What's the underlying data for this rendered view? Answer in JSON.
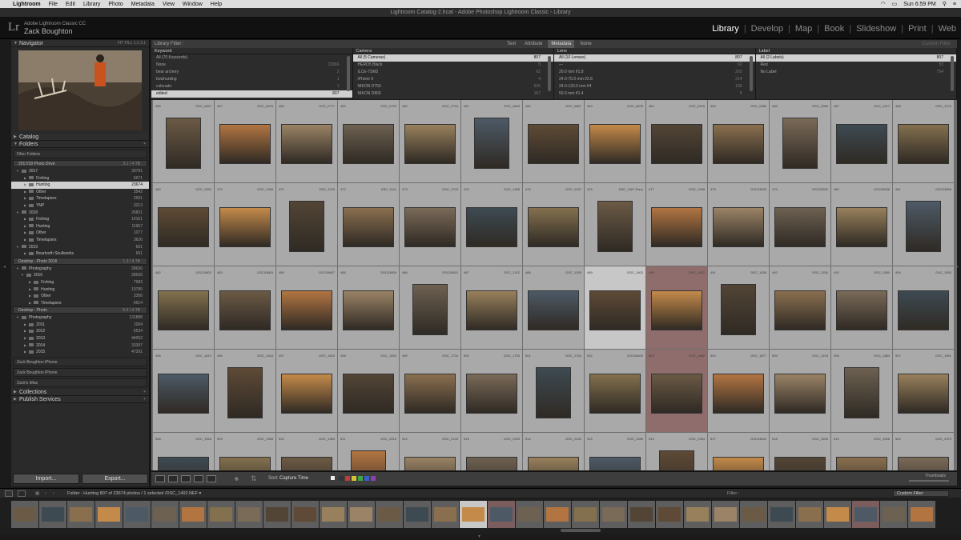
{
  "menubar": {
    "app": "Lightroom",
    "menus": [
      "File",
      "Edit",
      "Library",
      "Photo",
      "Metadata",
      "View",
      "Window",
      "Help"
    ],
    "clock": "Sun 6:59 PM"
  },
  "window_title": "Lightroom Catalog-2.lrcat - Adobe Photoshop Lightroom Classic - Library",
  "identity": {
    "logo": "Lr",
    "line1": "Adobe Lightroom Classic CC",
    "line2": "Zack Boughton"
  },
  "modules": {
    "library": "Library",
    "develop": "Develop",
    "map": "Map",
    "book": "Book",
    "slideshow": "Slideshow",
    "print": "Print",
    "web": "Web",
    "sep": "|"
  },
  "left": {
    "navigator": "Navigator",
    "nav_zoom": "FIT  FILL  1:1  3:1",
    "catalog": "Catalog",
    "folders": "Folders",
    "filter_placeholder": "Filter Folders",
    "vol1": {
      "name": "2017/18 Photo Drive",
      "n": "3.1 / 4 TB"
    },
    "f2017": {
      "name": "2017",
      "n": "39791"
    },
    "f_fishing": {
      "name": "Fishing",
      "n": "6671"
    },
    "f_hunting": {
      "name": "Hunting",
      "n": "23674"
    },
    "f_other": {
      "name": "Other",
      "n": "3542"
    },
    "f_timelapses": {
      "name": "Timelapses",
      "n": "2691"
    },
    "f_ynp": {
      "name": "YNP",
      "n": "3213"
    },
    "f2018": {
      "name": "2018",
      "n": "26831"
    },
    "f18_fishing": {
      "name": "Fishing",
      "n": "10161"
    },
    "f18_hunting": {
      "name": "Hunting",
      "n": "11967"
    },
    "f18_other": {
      "name": "Other",
      "n": "1077"
    },
    "f18_time": {
      "name": "Timelapses",
      "n": "3626"
    },
    "f2019": {
      "name": "2019",
      "n": "691"
    },
    "f19_bs": {
      "name": "Beartooth Skullworks",
      "n": "691"
    },
    "vol2": {
      "name": "Desktop - Photo 2016",
      "n": "1.3 / 4 TB"
    },
    "d_photo": {
      "name": "Photography",
      "n": "28636"
    },
    "d2016": {
      "name": "2016",
      "n": "28636"
    },
    "d16_fish": {
      "name": "Fishing",
      "n": "7983"
    },
    "d16_hunt": {
      "name": "Hunting",
      "n": "10785"
    },
    "d16_other": {
      "name": "Other",
      "n": "3356"
    },
    "d16_time": {
      "name": "Timelapses",
      "n": "6514"
    },
    "vol3": {
      "name": "Desktop - Photo",
      "n": "0.6 / 4 TB"
    },
    "e_photo": {
      "name": "Photography",
      "n": "131888"
    },
    "e2011": {
      "name": "2011",
      "n": "1004"
    },
    "e2012": {
      "name": "2012",
      "n": "5534"
    },
    "e2013": {
      "name": "2013",
      "n": "44062"
    },
    "e2014": {
      "name": "2014",
      "n": "33397"
    },
    "e2015": {
      "name": "2015",
      "n": "47291"
    },
    "iphone1": "Zack Boughton iPhone",
    "iphone2": "Zack Boughton iPhone",
    "imac": "Zack's iMac",
    "collections": "Collections",
    "publish": "Publish Services",
    "import": "Import...",
    "export": "Export..."
  },
  "filterbar": {
    "label": "Library Filter :",
    "text": "Text",
    "attribute": "Attribute",
    "metadata": "Metadata",
    "none": "None",
    "custom": "Custom Filter"
  },
  "meta": {
    "keyword": {
      "title": "Keyword",
      "rows": [
        [
          "All (70 Keywords)",
          ""
        ],
        [
          "None",
          "22866"
        ],
        [
          "bear archery",
          "2"
        ],
        [
          "bowhunting",
          "1"
        ],
        [
          "colorado",
          "1"
        ],
        [
          "edited",
          "807"
        ]
      ]
    },
    "camera": {
      "title": "Camera",
      "rows": [
        [
          "All (5 Cameras)",
          "807"
        ],
        [
          "HERO5 Black",
          "5"
        ],
        [
          "ILCE-7SM2",
          "62"
        ],
        [
          "iPhone 6",
          "4"
        ],
        [
          "NIKON D750",
          "535"
        ],
        [
          "NIKON D800",
          "167"
        ]
      ]
    },
    "lens": {
      "title": "Lens",
      "rows": [
        [
          "All (10 Lenses)",
          "807"
        ],
        [
          "—",
          "62"
        ],
        [
          "20.0 mm f/1.8",
          "203"
        ],
        [
          "24.0-70.0 mm f/2.8",
          "214"
        ],
        [
          "24.0-120.0 mm f/4",
          "196"
        ],
        [
          "50.0 mm f/1.4",
          "5"
        ]
      ]
    },
    "label": {
      "title": "Label",
      "rows": [
        [
          "All (2 Labels)",
          "807"
        ],
        [
          "Red",
          "53"
        ],
        [
          "No Label",
          "754"
        ]
      ]
    }
  },
  "grid": {
    "rows": [
      [
        [
          "456",
          "DSC_0647"
        ],
        [
          "457",
          "DSC_0678"
        ],
        [
          "458",
          "DSC_0777"
        ],
        [
          "459",
          "DSC_0793"
        ],
        [
          "460",
          "DSC_0794"
        ],
        [
          "461",
          "DSC_0843"
        ],
        [
          "462",
          "DSC_0867"
        ],
        [
          "463",
          "DSC_0878"
        ],
        [
          "464",
          "DSC_0915"
        ],
        [
          "465",
          "DSC_0986"
        ],
        [
          "466",
          "DSC_0998"
        ],
        [
          "467",
          "DSC_1017"
        ],
        [
          "468",
          "DSC_1074"
        ]
      ],
      [
        [
          "469",
          "DSC_1092"
        ],
        [
          "470",
          "DSC_1098"
        ],
        [
          "471",
          "DSC_1133"
        ],
        [
          "472",
          "DSC_1141"
        ],
        [
          "473",
          "DSC_1275"
        ],
        [
          "474",
          "DSC_1285"
        ],
        [
          "475",
          "DSC_1297"
        ],
        [
          "476",
          "DSC_1307-Pano"
        ],
        [
          "477",
          "DSC_1308"
        ],
        [
          "478",
          "DSC03530"
        ],
        [
          "479",
          "DSC03531"
        ],
        [
          "480",
          "DSC03536"
        ],
        [
          "481",
          "DSC03589"
        ]
      ],
      [
        [
          "482",
          "DSC03602"
        ],
        [
          "483",
          "DSC03605"
        ],
        [
          "484",
          "DSC03607"
        ],
        [
          "485",
          "DSC03609"
        ],
        [
          "486",
          "DSC03615"
        ],
        [
          "487",
          "DSC_1312"
        ],
        [
          "488",
          "DSC_1393"
        ],
        [
          "489",
          "DSC_1402"
        ],
        [
          "490",
          "DSC_1422"
        ],
        [
          "491",
          "DSC_1438"
        ],
        [
          "492",
          "DSC_1534"
        ],
        [
          "493",
          "DSC_1550"
        ],
        [
          "494",
          "DSC_1593"
        ]
      ],
      [
        [
          "495",
          "DSC_1610"
        ],
        [
          "496",
          "DSC_1618"
        ],
        [
          "497",
          "DSC_1620"
        ],
        [
          "498",
          "DSC_1633"
        ],
        [
          "499",
          "DSC_1734"
        ],
        [
          "500",
          "DSC_1753"
        ],
        [
          "501",
          "DSC_1764"
        ],
        [
          "502",
          "DSC03624"
        ],
        [
          "503",
          "DSC_1862"
        ],
        [
          "504",
          "DSC_1877"
        ],
        [
          "505",
          "DSC_1878"
        ],
        [
          "506",
          "DSC_1884"
        ],
        [
          "507",
          "DSC_1951"
        ]
      ],
      [
        [
          "508",
          "DSC_1953"
        ],
        [
          "509",
          "DSC_1968"
        ],
        [
          "510",
          "DSC_1983"
        ],
        [
          "511",
          "DSC_2016"
        ],
        [
          "512",
          "DSC_2149"
        ],
        [
          "513",
          "DSC_2209"
        ],
        [
          "514",
          "DSC_2232"
        ],
        [
          "515",
          "DSC_2289"
        ],
        [
          "516",
          "DSC_2353"
        ],
        [
          "517",
          "DSC03642"
        ],
        [
          "518",
          "DSC_2490"
        ],
        [
          "519",
          "DSC_2506"
        ],
        [
          "520",
          "DSC_2579"
        ]
      ]
    ]
  },
  "toolbar": {
    "sort": "Sort:",
    "sort_value": "Capture Time",
    "thumbnails": "Thumbnails"
  },
  "filmstrip_bar": {
    "info": "Folder : Hunting      807 of 23674 photos / 1 selected /DSC_1402.NEF ▾",
    "filter": "Filter :",
    "custom": "Custom Filter"
  },
  "colors": {
    "accent": "#ffffff",
    "red_label": "#8f6d6d",
    "selected": "#c7c7c7"
  }
}
